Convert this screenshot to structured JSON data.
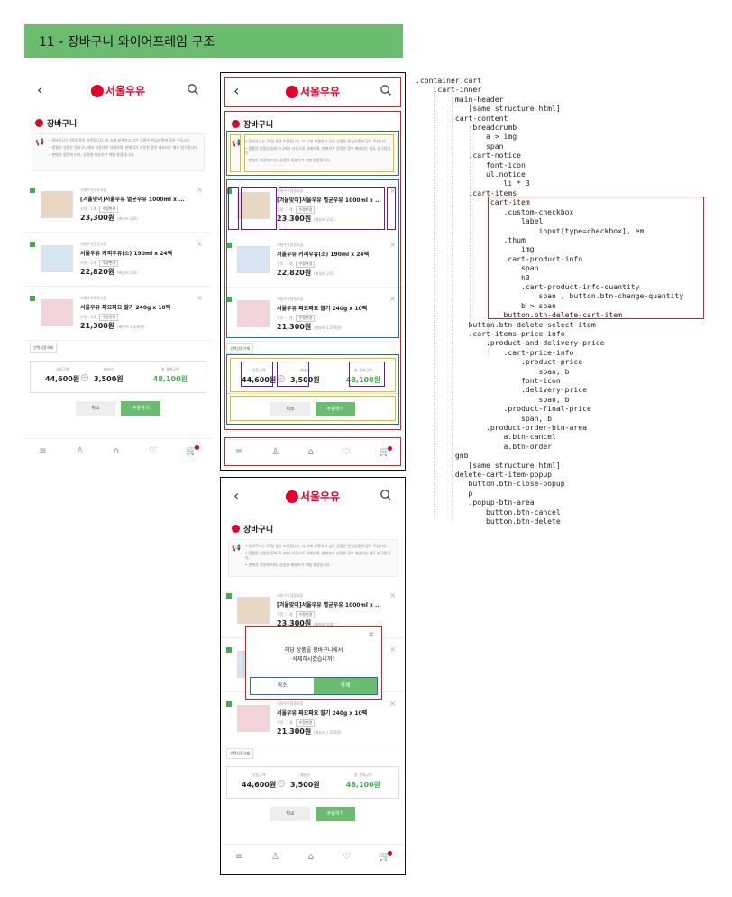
{
  "title": "11 - 장바구니 와이어프레임 구조",
  "header": {
    "back_icon": "chevron-left-icon",
    "brand": "서울우유",
    "search_icon": "search-icon"
  },
  "cart_title": "장바구니",
  "notice": [
    "장바구니는 30일 동안 보관됩니다. 더 오래 보관하고 싶은 상품은 관심상품에 담아 주십시오.",
    "품절된 상품은 장바구니에서 자동으로 삭제되며, 판매자가 선정한 경우 배송비는 별도 청구됩니다.",
    "판매자 설정에 따라, 상품별 배송비가 개별 발생됩니다."
  ],
  "items": [
    {
      "brand": "서울우유협동조합",
      "name": "[겨울맞이]서울우유 멸균우유 1000ml x ...",
      "qty": "수량 : 1개",
      "change": "수량변경",
      "price": "23,300원",
      "delivery": "(배송비 무료)"
    },
    {
      "brand": "서울우유협동조합",
      "name": "서울우유 커피우유(소) 190ml x 24팩",
      "qty": "수량 : 1개",
      "change": "수량변경",
      "price": "22,820원",
      "delivery": "(배송비 무료)"
    },
    {
      "brand": "서울우유협동조합",
      "name": "서울우유 짜요짜요 딸기 240g x 10팩",
      "qty": "수량 : 1개",
      "change": "수량변경",
      "price": "21,300원",
      "delivery": "(배송비 1,500원)"
    }
  ],
  "select_delete": "선택상품삭제",
  "summary": {
    "product_label": "상품금액",
    "product_value": "44,600원",
    "delivery_label": "배송비",
    "delivery_value": "3,500원",
    "final_label": "총 결제금액",
    "final_value": "48,100원"
  },
  "buttons": {
    "cancel": "취소",
    "order": "주문하기"
  },
  "gnb": [
    "menu-icon",
    "user-icon",
    "home-icon",
    "heart-icon",
    "cart-icon"
  ],
  "popup": {
    "line1": "해당 상품을 장바구니에서",
    "line2": "삭제하시겠습니까?",
    "cancel": "취소",
    "delete": "삭제"
  },
  "code": [
    ".container.cart",
    "    .cart-inner",
    "        .main-header",
    "            [same structure html]",
    "        .cart-content",
    "            .breadcrumb",
    "                a > img",
    "                span",
    "            .cart-notice",
    "                font-icon",
    "                ul.notice",
    "                    li * 3",
    "            .cart-items",
    "                .cart-item",
    "                    .custom-checkbox",
    "                        label",
    "                            input[type=checkbox], em",
    "                    .thum",
    "                        img",
    "                    .cart-product-info",
    "                        span",
    "                        h3",
    "                        .cart-product-info-quantity",
    "                            span , button.btn-change-quantity",
    "                        b > span",
    "                    button.btn-delete-cart-item",
    "            button.btn-delete-select-item",
    "            .cart-items-price-info",
    "                .product-and-delivery-price",
    "                    .cart-price-info",
    "                        .product-price",
    "                            span, b",
    "                        font-icon",
    "                        .delivery-price",
    "                            span, b",
    "                    .product-final-price",
    "                        span, b",
    "                .product-order-btn-area",
    "                    a.btn-cancel",
    "                    a.btn-order",
    "        .gnb",
    "            [same structure html]",
    "        .delete-cart-item-popup",
    "            button.btn-close-popup",
    "            p",
    "            .popup-btn-area",
    "                button.btn-cancel",
    "                button.btn-delete"
  ]
}
